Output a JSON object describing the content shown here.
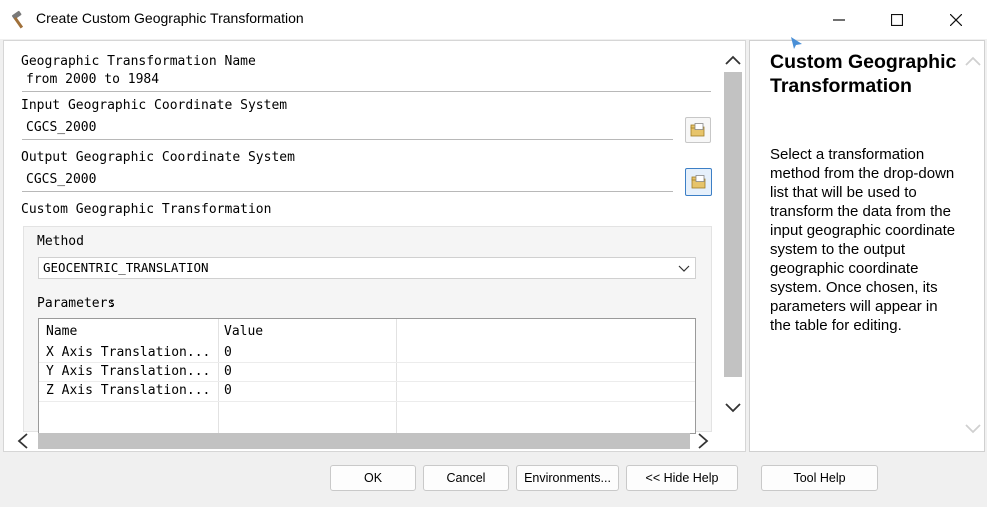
{
  "window": {
    "title": "Create Custom Geographic Transformation"
  },
  "form": {
    "name_label": "Geographic Transformation Name",
    "name_value": "from 2000 to 1984",
    "input_gcs_label": "Input Geographic Coordinate System",
    "input_gcs_value": "CGCS_2000",
    "output_gcs_label": "Output Geographic Coordinate System",
    "output_gcs_value": "CGCS_2000",
    "custom_section_label": "Custom Geographic Transformation",
    "method_label": "Method",
    "method_value": "GEOCENTRIC_TRANSLATION",
    "parameters_label": "Parameters",
    "param_headers": [
      "Name",
      "Value"
    ],
    "params": [
      {
        "name": "X Axis Translation...",
        "value": "0"
      },
      {
        "name": "Y Axis Translation...",
        "value": "0"
      },
      {
        "name": "Z Axis Translation...",
        "value": "0"
      }
    ]
  },
  "help": {
    "title": "Custom Geographic Transformation",
    "body": "Select a transformation method from the drop-down list that will be used to transform the data from the input geographic coordinate system to the output geographic coordinate system. Once chosen, its parameters will appear in the table for editing."
  },
  "buttons": {
    "ok": "OK",
    "cancel": "Cancel",
    "environments": "Environments...",
    "hide_help": "<< Hide Help",
    "tool_help": "Tool Help"
  },
  "icons": {
    "app": "hammer-icon",
    "minimize": "minimize-icon",
    "maximize": "maximize-icon",
    "close": "close-icon",
    "browse": "open-folder-icon"
  }
}
